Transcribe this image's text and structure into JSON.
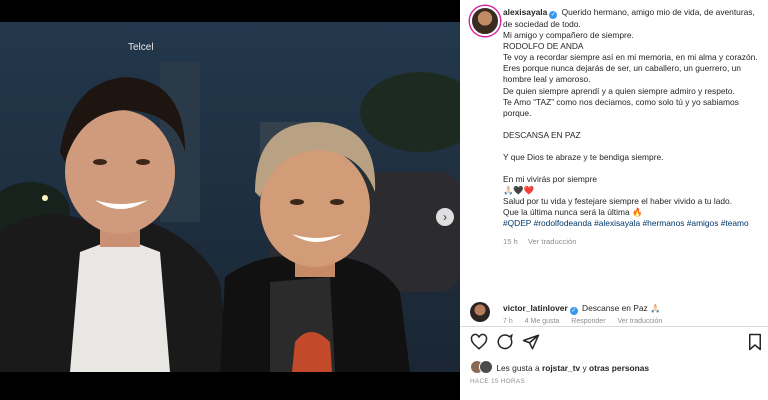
{
  "post": {
    "username": "alexisayala",
    "caption_lines": [
      "Querido hermano, amigo mio de vida, de aventuras, de sociedad de todo.",
      "Mi amigo y compañero de siempre.",
      "RODOLFO DE ANDA",
      "Te voy a recordar siempre así en mi memoria, en mi alma y corazón.",
      "Eres porque nunca dejarás de ser, un caballero, un guerrero, un hombre leal y amoroso.",
      "De quien siempre aprendí y a quien siempre admiro y respeto.",
      "Te Amo “TAZ” como nos deciamos, como solo tú y yo sabiamos porque.",
      "DESCANSA EN PAZ",
      "Y que Dios te abraze y te bendiga siempre.",
      "En mi vivirás por siempre",
      "🙏🏻🖤❤️",
      "Salud por tu vida y festejare siempre el haber vivido a tu lado.",
      "Que la última nunca será la última 🔥"
    ],
    "hashtags": "#QDEP #rodolfodeanda #alexisayala #hermanos #amigos #teamo",
    "time_ago": "15 h",
    "see_translation": "Ver traducción",
    "photo_sign_text": "Telcel"
  },
  "comment": {
    "username": "victor_latinlover",
    "text": "Descanse en Paz 🙏🏻",
    "time": "7 h",
    "likes": "4 Me gusta",
    "reply": "Responder",
    "see_translation": "Ver traducción"
  },
  "likes_line": {
    "prefix": "Les gusta a ",
    "user": "rojstar_tv",
    "middle": " y ",
    "others": "otras personas"
  },
  "timestamp": "HACE 15 HORAS",
  "icons": {
    "like": "heart-icon",
    "comment": "comment-icon",
    "share": "share-icon",
    "save": "bookmark-icon",
    "verified": "verified-badge-icon",
    "next": "chevron-right-icon"
  },
  "colors": {
    "link": "#00376b",
    "verified": "#3897f0",
    "meta": "#8e8e8e"
  }
}
